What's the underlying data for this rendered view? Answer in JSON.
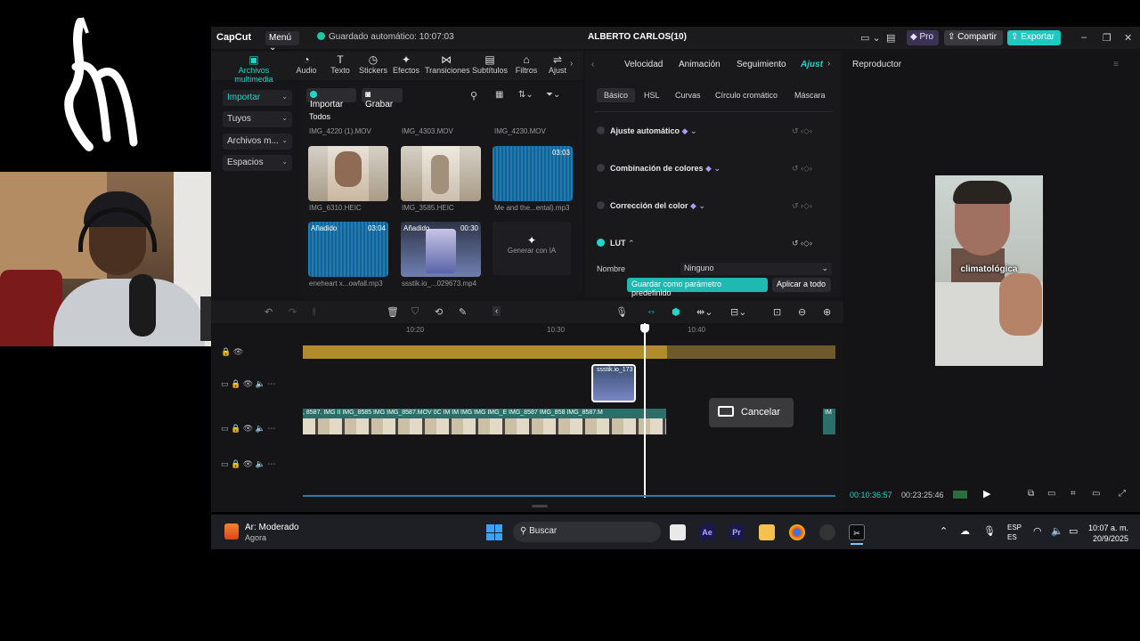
{
  "app": {
    "brand": "CapCut",
    "menu_label": "Menú",
    "autosave": "Guardado automático: 10:07:03",
    "project_title": "ALBERTO CARLOS(10)",
    "pro_label": "Pro",
    "share_label": "Compartir",
    "export_label": "Exportar",
    "accent_color": "#21d6c9"
  },
  "media_toolbar": [
    {
      "label": "Archivos multimedia",
      "icon": "media-icon",
      "active": true
    },
    {
      "label": "Audio",
      "icon": "audio-icon"
    },
    {
      "label": "Texto",
      "icon": "text-icon"
    },
    {
      "label": "Stickers",
      "icon": "sticker-icon"
    },
    {
      "label": "Efectos",
      "icon": "effects-icon"
    },
    {
      "label": "Transiciones",
      "icon": "transitions-icon"
    },
    {
      "label": "Subtítulos",
      "icon": "subtitles-icon"
    },
    {
      "label": "Filtros",
      "icon": "filters-icon"
    },
    {
      "label": "Ajust",
      "icon": "adjust-icon"
    }
  ],
  "sidebar": {
    "items": [
      {
        "label": "Importar",
        "active": true
      },
      {
        "label": "Tuyos"
      },
      {
        "label": "Archivos m..."
      },
      {
        "label": "Espacios"
      }
    ]
  },
  "media": {
    "import_label": "Importar",
    "record_label": "Grabar",
    "tab_all": "Todos",
    "top_labels": [
      "IMG_4220 (1).MOV",
      "IMG_4303.MOV",
      "IMG_4230.MOV"
    ],
    "row1": [
      {
        "label": "IMG_6310.HEIC",
        "kind": "photo"
      },
      {
        "label": "IMG_3585.HEIC",
        "kind": "photo"
      },
      {
        "label": "Me and the...ental).mp3",
        "kind": "audio",
        "duration": "03:03"
      }
    ],
    "row2": [
      {
        "label": "eneheart x...owfall.mp3",
        "kind": "audio",
        "badge": "Añadido",
        "duration": "03:04"
      },
      {
        "label": "ssstik.io_...029673.mp4",
        "kind": "video",
        "badge": "Añadido",
        "duration": "00:30"
      }
    ],
    "generate_ai": "Generar con IA"
  },
  "props": {
    "tabs": [
      "Velocidad",
      "Animación",
      "Seguimiento",
      "Ajust"
    ],
    "active_tab": "Ajust",
    "subtabs": [
      "Básico",
      "HSL",
      "Curvas",
      "Círculo cromático",
      "Máscara"
    ],
    "rows": [
      {
        "label": "Ajuste automático",
        "on": false
      },
      {
        "label": "Combinación de colores",
        "on": false
      },
      {
        "label": "Corrección del color",
        "on": false
      },
      {
        "label": "LUT",
        "on": true
      }
    ],
    "name_label": "Nombre",
    "name_value": "Ninguno",
    "save_preset": "Guardar como parámetro predefinido",
    "apply_all": "Aplicar a todo"
  },
  "player": {
    "title": "Reproductor",
    "caption": "climatológica",
    "time_current": "00:10:36:57",
    "time_total": "00:23:25:46"
  },
  "timeline": {
    "ruler": [
      "10:20",
      "10:30",
      "10:40"
    ],
    "selected_clip": "ssstik.io_173",
    "main_track_names": ", 8587. IMG   II IMG_8585 IMG IMG_8587.MOV 0C IM IM IMG IMG IMG_E IMG_8587 IMG_858 IMG_8587.M",
    "cancel_label": "Cancelar",
    "main_end_label": "IM"
  },
  "taskbar": {
    "weather_title": "Ar: Moderado",
    "weather_sub": "Agora",
    "search": "Buscar",
    "lang1": "ESP",
    "lang2": "ES",
    "time": "10:07 a. m.",
    "date": "20/9/2025"
  }
}
